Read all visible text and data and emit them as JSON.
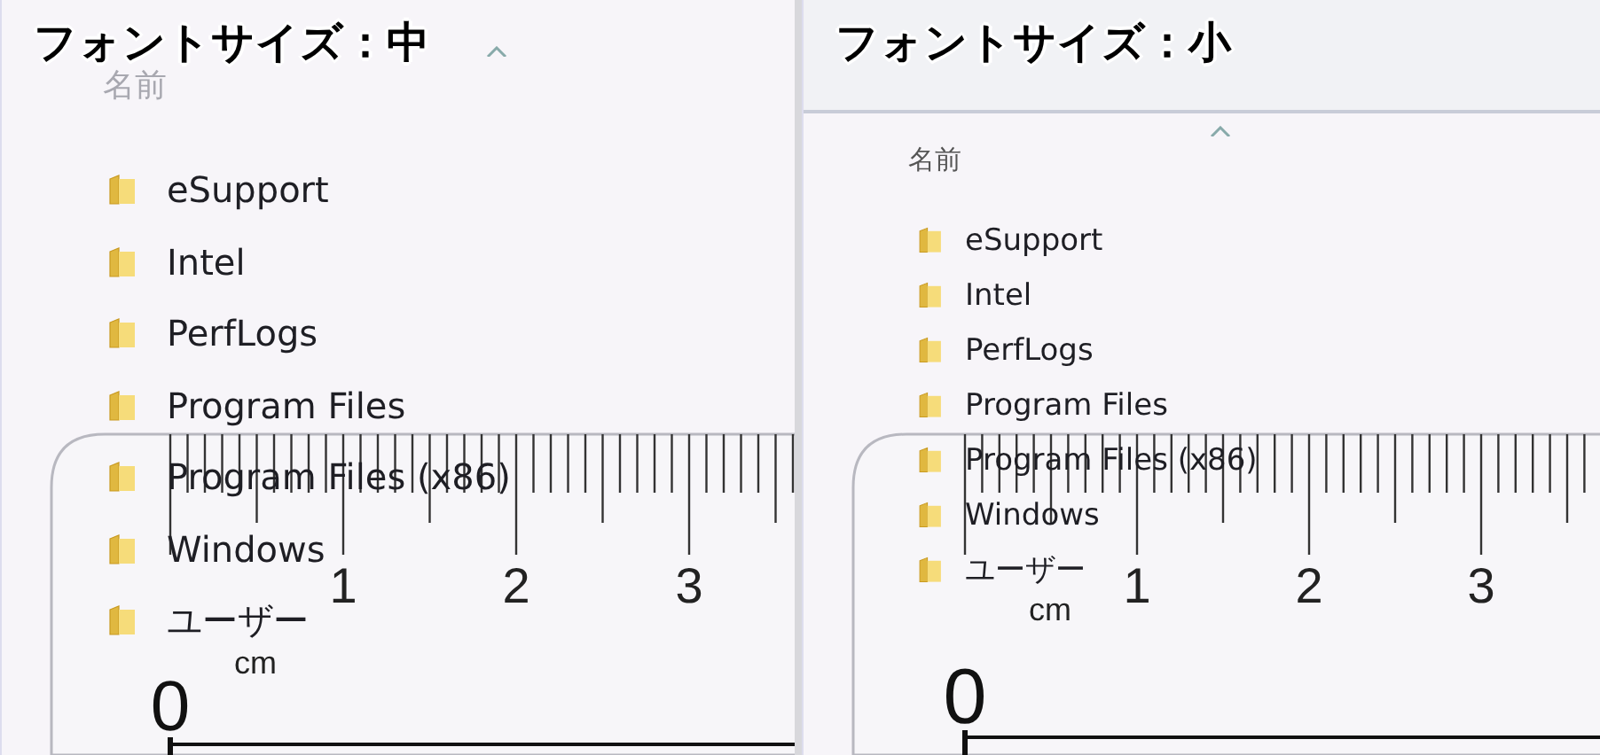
{
  "panels": [
    {
      "caption": "フォントサイズ：中",
      "column_header": "名前",
      "items": [
        "eSupport",
        "Intel",
        "PerfLogs",
        "Program Files",
        "Program Files (x86)",
        "Windows",
        "ユーザー"
      ],
      "ruler": {
        "unit": "cm",
        "labels": [
          "0",
          "1",
          "2",
          "3"
        ]
      }
    },
    {
      "caption": "フォントサイズ：小",
      "column_header": "名前",
      "items": [
        "eSupport",
        "Intel",
        "PerfLogs",
        "Program Files",
        "Program Files (x86)",
        "Windows",
        "ユーザー"
      ],
      "ruler": {
        "unit": "cm",
        "labels": [
          "0",
          "1",
          "2",
          "3"
        ]
      }
    }
  ]
}
